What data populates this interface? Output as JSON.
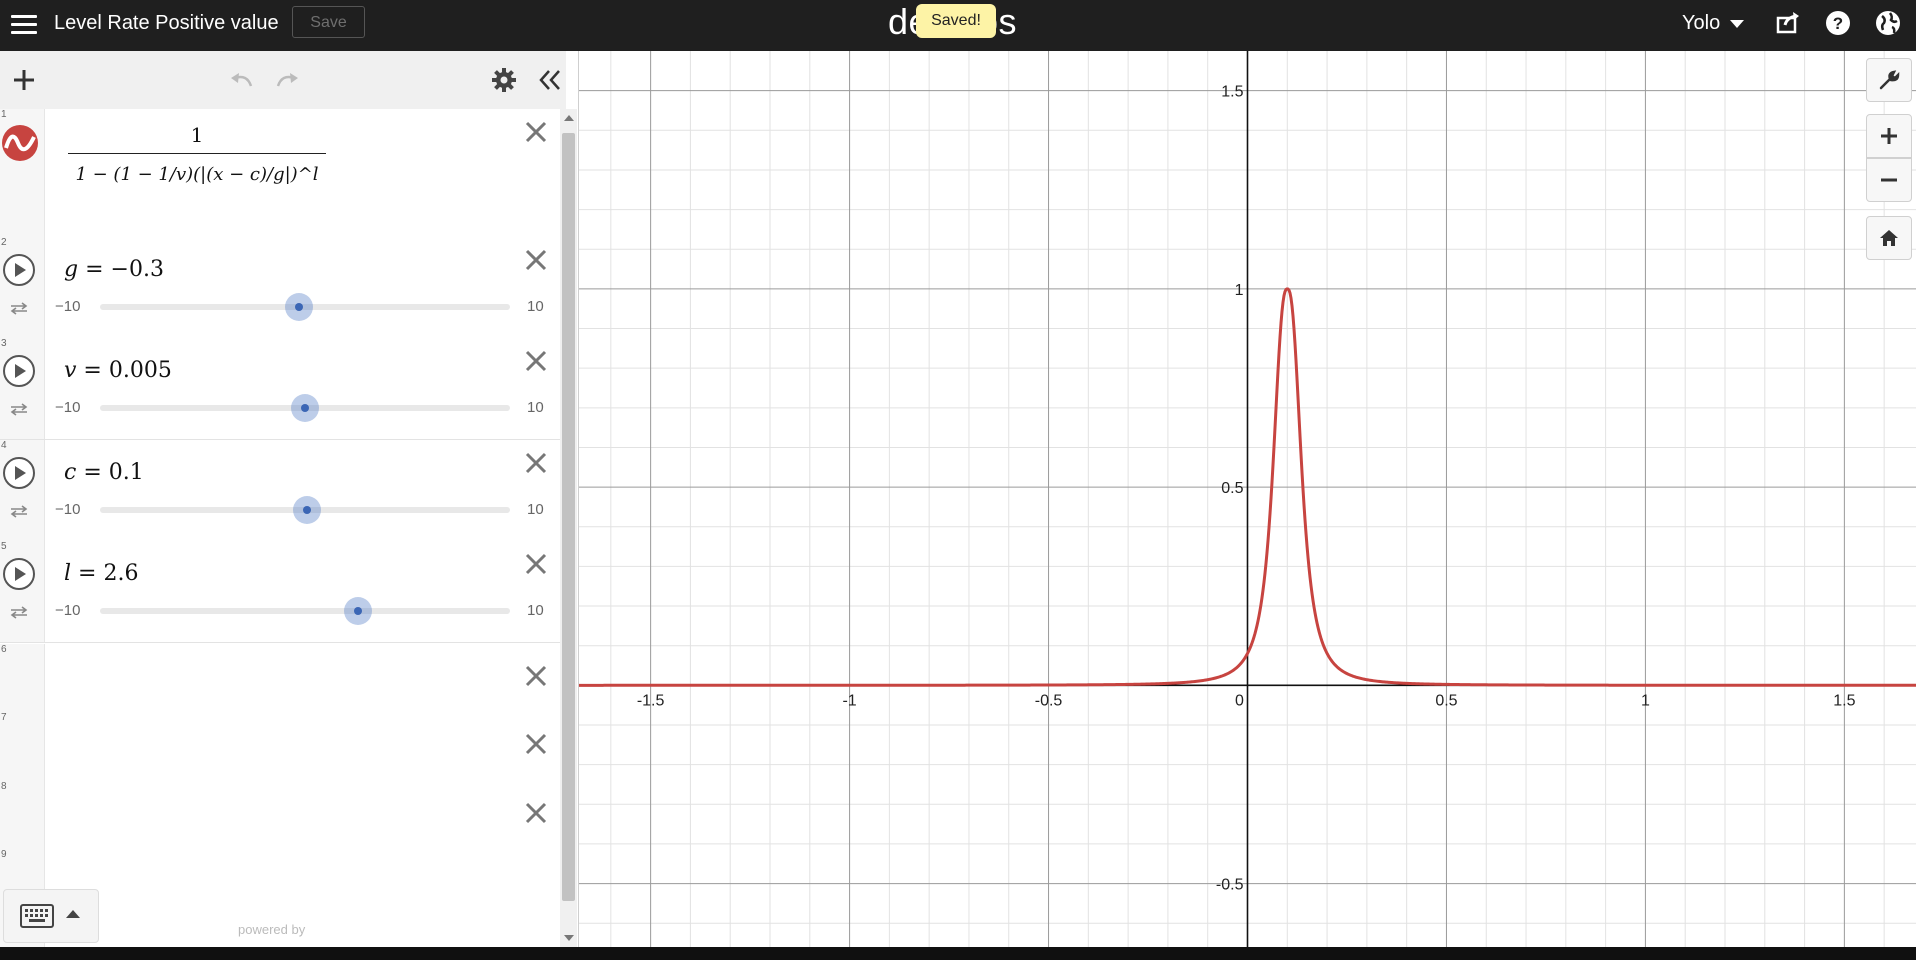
{
  "header": {
    "title": "Level Rate Positive value",
    "save_label": "Save",
    "logo": "desmos",
    "toast": "Saved!",
    "user": "Yolo"
  },
  "expressions": [
    {
      "num": "1",
      "type": "formula",
      "numerator": "1",
      "text": "1 − (1 − 1/v)(|(x − c)/g|)^l",
      "line_color": "#c74440"
    },
    {
      "num": "2",
      "type": "slider",
      "var": "g",
      "value": "−0.3",
      "min": "−10",
      "max": "10",
      "fraction": 0.485
    },
    {
      "num": "3",
      "type": "slider",
      "var": "v",
      "value": "0.005",
      "min": "−10",
      "max": "10",
      "fraction": 0.5
    },
    {
      "num": "4",
      "type": "slider",
      "var": "c",
      "value": "0.1",
      "min": "−10",
      "max": "10",
      "fraction": 0.505
    },
    {
      "num": "5",
      "type": "slider",
      "var": "l",
      "value": "2.6",
      "min": "−10",
      "max": "10",
      "fraction": 0.63
    },
    {
      "num": "6",
      "type": "empty"
    },
    {
      "num": "7",
      "type": "empty"
    },
    {
      "num": "8",
      "type": "empty"
    },
    {
      "num": "9",
      "type": "empty"
    }
  ],
  "panel": {
    "powered_by": "powered by"
  },
  "chart_data": {
    "type": "line",
    "xlim": [
      -1.68,
      1.68
    ],
    "ylim": [
      -0.66,
      1.6
    ],
    "x_ticks": [
      "-1.5",
      "-1",
      "-0.5",
      "0",
      "0.5",
      "1",
      "1.5"
    ],
    "y_ticks": [
      "1.5",
      "1",
      "0.5",
      "-0.5"
    ],
    "grid": true,
    "params": {
      "g": -0.3,
      "v": 0.005,
      "c": 0.1,
      "l": 2.6
    },
    "series_color": "#c74440"
  },
  "colors": {
    "accent": "#c74440",
    "slider": "#3b66b5",
    "topbar": "#1f1f1f"
  },
  "icons": [
    "menu-icon",
    "share-icon",
    "help-icon",
    "globe-icon",
    "add-icon",
    "undo-icon",
    "redo-icon",
    "settings-icon",
    "collapse-icon",
    "wrench-icon",
    "zoom-in-icon",
    "zoom-out-icon",
    "home-icon",
    "keyboard-icon",
    "play-icon",
    "loop-icon",
    "close-icon"
  ]
}
